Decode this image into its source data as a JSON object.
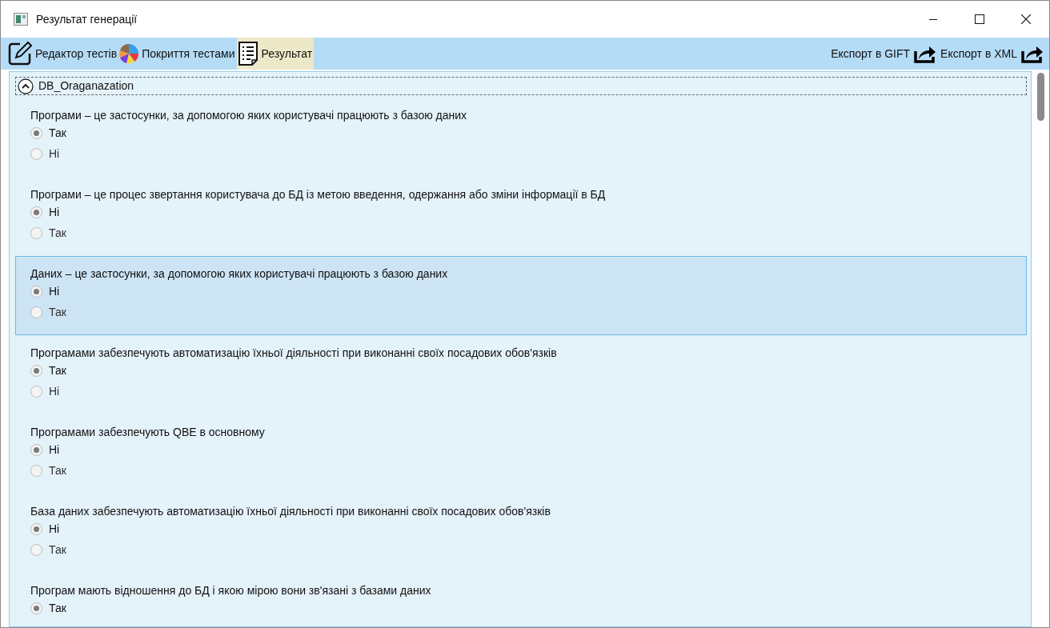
{
  "window": {
    "title": "Результат генерації"
  },
  "toolbar": {
    "left": [
      {
        "kind": "edit",
        "label": "Редактор тестів",
        "selected": false
      },
      {
        "kind": "pie",
        "label": "Покриття тестами",
        "selected": false
      },
      {
        "kind": "list",
        "label": "Результат",
        "selected": true
      }
    ],
    "right": [
      {
        "label": "Експорт в GIFT"
      },
      {
        "label": "Експорт в XML"
      }
    ]
  },
  "group": {
    "title": "DB_Oraganazation",
    "expanded": true,
    "questions": [
      {
        "text": "Програми – це застосунки, за допомогою яких користувачі працюють з базою даних",
        "selected": false,
        "options": [
          {
            "label": "Так",
            "checked": true
          },
          {
            "label": "Ні",
            "checked": false
          }
        ]
      },
      {
        "text": "Програми – це процес звертання користувача до БД із метою введення, одержання або зміни інформації в БД",
        "selected": false,
        "options": [
          {
            "label": "Ні",
            "checked": true
          },
          {
            "label": "Так",
            "checked": false
          }
        ]
      },
      {
        "text": "Даних – це застосунки, за допомогою яких користувачі працюють з базою даних",
        "selected": true,
        "options": [
          {
            "label": "Ні",
            "checked": true
          },
          {
            "label": "Так",
            "checked": false
          }
        ]
      },
      {
        "text": "Програмами забезпечують автоматизацію їхньої діяльності при виконанні своїх посадових обов'язків",
        "selected": false,
        "options": [
          {
            "label": "Так",
            "checked": true
          },
          {
            "label": "Ні",
            "checked": false
          }
        ]
      },
      {
        "text": "Програмами забезпечують QBE в основному",
        "selected": false,
        "options": [
          {
            "label": "Ні",
            "checked": true
          },
          {
            "label": "Так",
            "checked": false
          }
        ]
      },
      {
        "text": "База даних забезпечують автоматизацію їхньої діяльності при виконанні своїх посадових обов'язків",
        "selected": false,
        "options": [
          {
            "label": "Ні",
            "checked": true
          },
          {
            "label": "Так",
            "checked": false
          }
        ]
      },
      {
        "text": "Програм мають відношення до БД і якою мірою вони зв'язані з базами даних",
        "selected": false,
        "options": [
          {
            "label": "Так",
            "checked": true
          }
        ]
      }
    ]
  }
}
